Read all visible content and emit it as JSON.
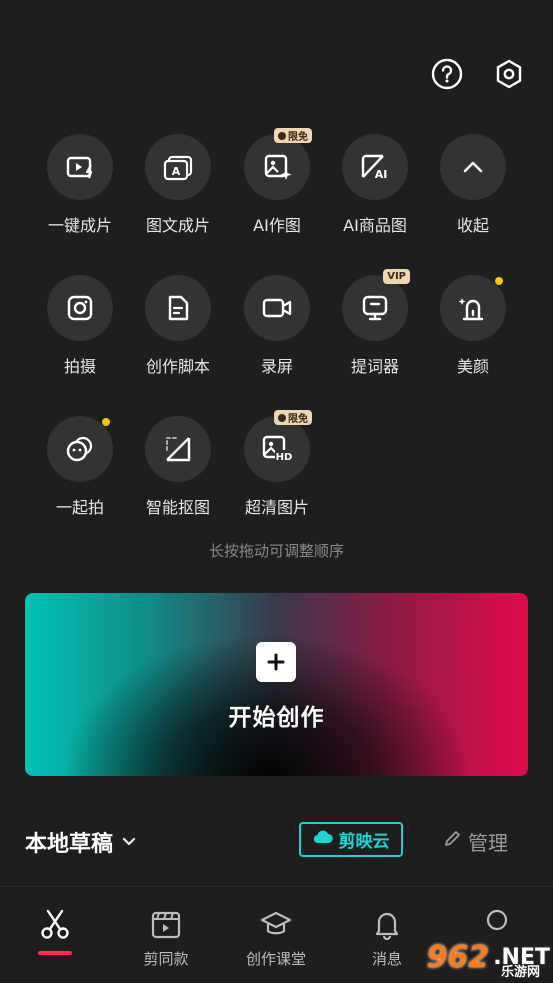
{
  "tools": [
    {
      "label": "一键成片",
      "icon": "one-click-video-icon"
    },
    {
      "label": "图文成片",
      "icon": "image-text-video-icon"
    },
    {
      "label": "AI作图",
      "icon": "ai-image-icon",
      "badge": "限免"
    },
    {
      "label": "AI商品图",
      "icon": "ai-product-image-icon"
    },
    {
      "label": "收起",
      "icon": "chevron-up-icon"
    },
    {
      "label": "拍摄",
      "icon": "camera-icon"
    },
    {
      "label": "创作脚本",
      "icon": "script-icon"
    },
    {
      "label": "录屏",
      "icon": "screen-record-icon"
    },
    {
      "label": "提词器",
      "icon": "teleprompter-icon",
      "badge": "VIP"
    },
    {
      "label": "美颜",
      "icon": "beauty-icon",
      "dot": true
    },
    {
      "label": "一起拍",
      "icon": "shoot-together-icon",
      "dot": true
    },
    {
      "label": "智能抠图",
      "icon": "smart-cutout-icon"
    },
    {
      "label": "超清图片",
      "icon": "hd-image-icon",
      "badge": "限免"
    }
  ],
  "hint": "长按拖动可调整顺序",
  "create_label": "开始创作",
  "drafts": {
    "title": "本地草稿",
    "cloud_label": "剪映云",
    "manage_label": "管理"
  },
  "nav": [
    {
      "label": "",
      "icon": "scissors-icon",
      "active": true
    },
    {
      "label": "剪同款",
      "icon": "template-icon"
    },
    {
      "label": "创作课堂",
      "icon": "graduation-cap-icon"
    },
    {
      "label": "消息",
      "icon": "bell-icon"
    },
    {
      "label": "",
      "icon": "profile-icon"
    }
  ],
  "watermark": {
    "number": "962",
    "suffix": ".NET",
    "sub": "乐游网"
  },
  "colors": {
    "background": "#1e1e1e",
    "accent_cyan": "#1fd2d6",
    "accent_red": "#fe2c55",
    "badge": "#efd6b3",
    "dot": "#f7c600"
  }
}
